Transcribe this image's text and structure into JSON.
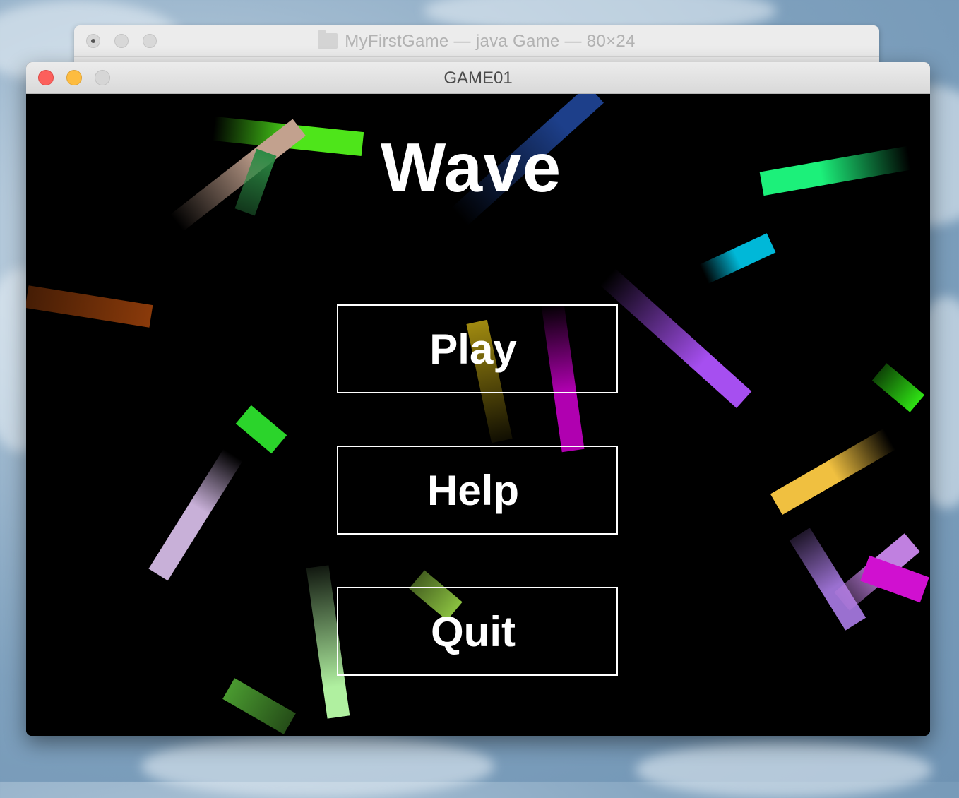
{
  "terminal_window": {
    "title": "MyFirstGame — java Game — 80×24",
    "icon": "folder-icon"
  },
  "game_window": {
    "title": "GAME01",
    "controls": [
      "close",
      "minimize",
      "zoom"
    ]
  },
  "game": {
    "title": "Wave",
    "menu": {
      "play": "Play",
      "help": "Help",
      "quit": "Quit"
    }
  },
  "colors": {
    "background": "#000000",
    "text": "#ffffff",
    "close": "#fc605c",
    "minimize": "#fdbc40",
    "particles": [
      "#4ee51a",
      "#c2a18e",
      "#2c8a44",
      "#1d3f8a",
      "#1cf07a",
      "#00b8d8",
      "#8a3a0a",
      "#a64ff0",
      "#b000b0",
      "#a08a10",
      "#2fe314",
      "#f0c040",
      "#9a70d0",
      "#c080e0",
      "#d010d0",
      "#2bd42b",
      "#c8b0d8",
      "#b0f0a0",
      "#8ac040",
      "#4a9a30"
    ]
  }
}
